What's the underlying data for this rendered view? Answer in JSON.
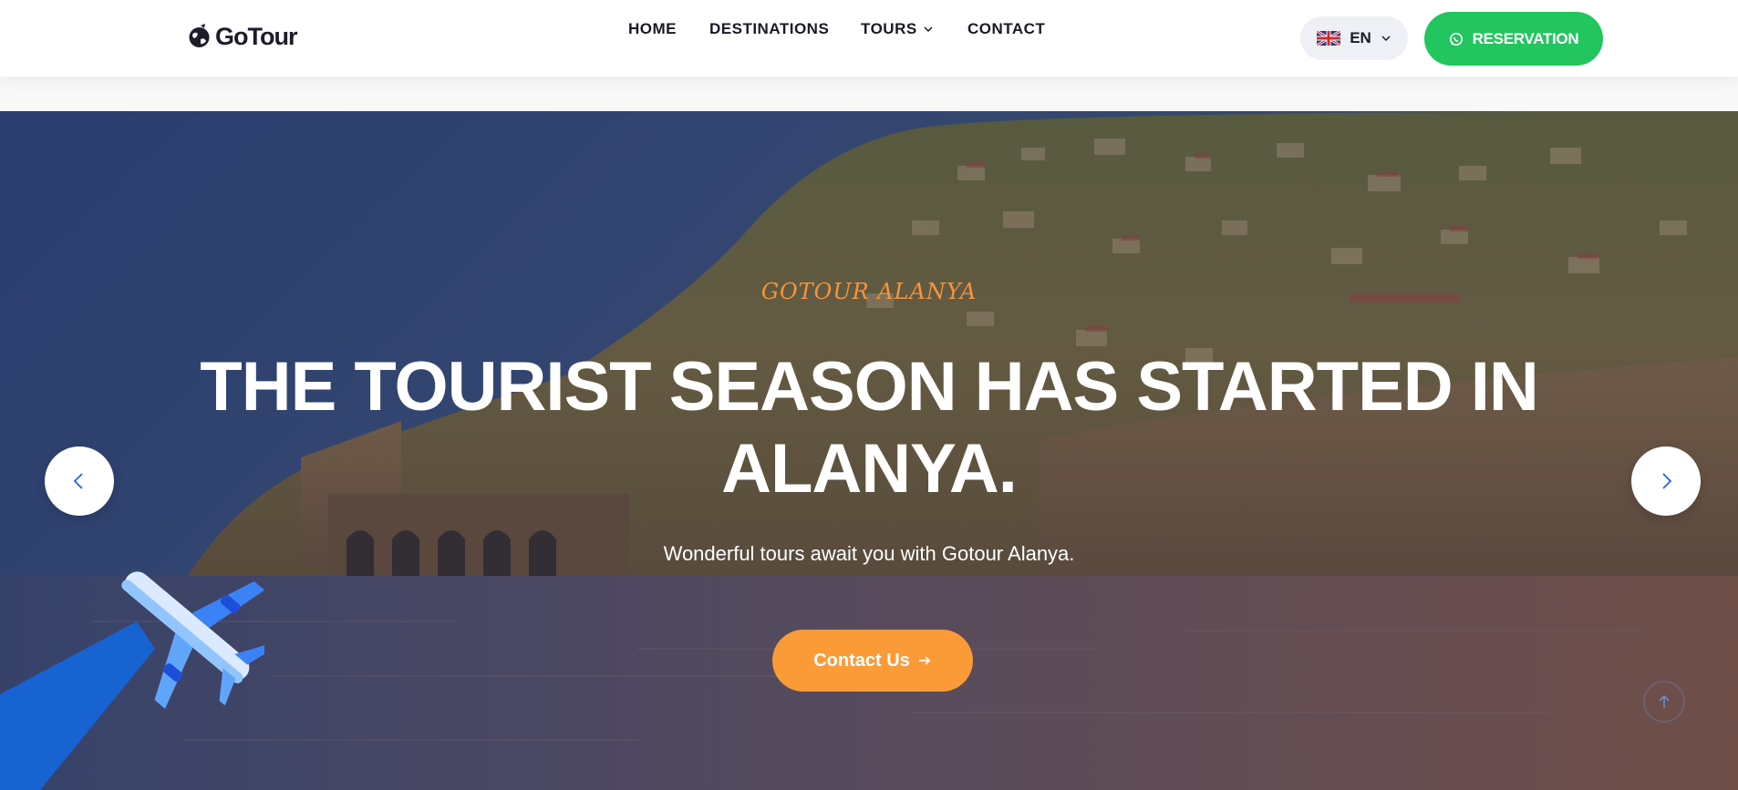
{
  "brand": {
    "name": "GoTour",
    "logo_icon": "globe-icon"
  },
  "nav": {
    "home": "HOME",
    "destinations": "DESTINATIONS",
    "tours": "TOURS",
    "contact": "CONTACT"
  },
  "language": {
    "code": "EN",
    "flag_icon": "uk-flag-icon"
  },
  "reservation": {
    "label": "RESERVATION",
    "icon": "whatsapp-icon"
  },
  "hero": {
    "tagline": "GOTOUR ALANYA",
    "headline": "THE TOURIST SEASON HAS STARTED IN ALANYA.",
    "subtitle": "Wonderful tours await you with Gotour Alanya.",
    "cta_label": "Contact Us"
  },
  "colors": {
    "reservation": "#22c55e",
    "cta": "#fb9b37",
    "tagline": "#f7953a",
    "text_dark": "#1a1a25"
  }
}
